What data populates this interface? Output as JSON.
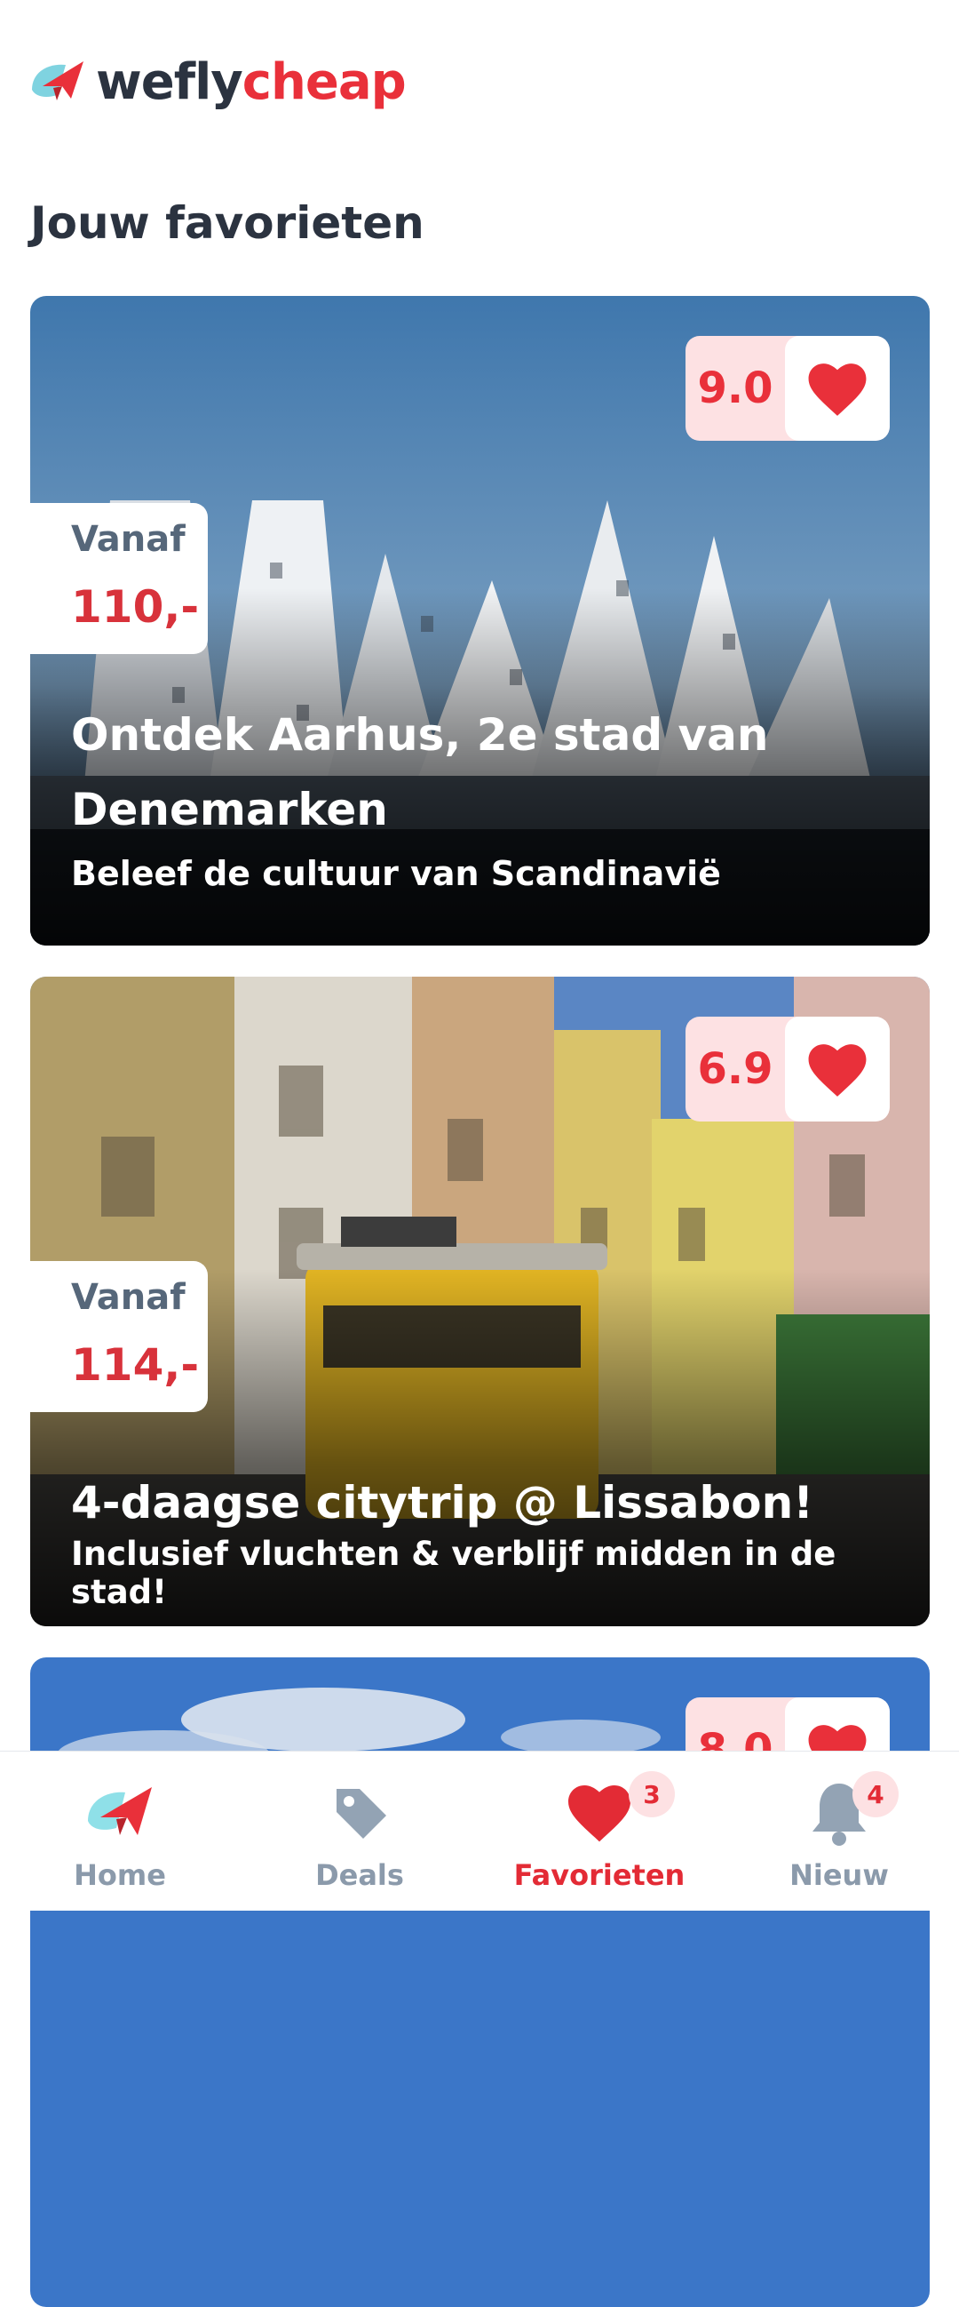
{
  "app": {
    "logo_we": "wefly",
    "logo_cheap": "cheap",
    "brand_color": "#e9303a"
  },
  "page": {
    "title": "Jouw favorieten"
  },
  "cards": [
    {
      "rating": "9.0",
      "price_label": "Vanaf",
      "price": "110,-",
      "title": "Ontdek Aarhus, 2e stad van Denemarken",
      "subtitle": "Beleef de cultuur van Scandinavië",
      "favorite_icon": "heart-icon"
    },
    {
      "rating": "6.9",
      "price_label": "Vanaf",
      "price": "114,-",
      "title": "4-daagse citytrip @ Lissabon!",
      "subtitle": "Inclusief vluchten & verblijf midden in de stad!",
      "favorite_icon": "heart-icon"
    },
    {
      "rating": "8.0",
      "favorite_icon": "heart-icon"
    }
  ],
  "tabbar": {
    "items": [
      {
        "label": "Home",
        "icon": "plane-logo-icon"
      },
      {
        "label": "Deals",
        "icon": "tag-icon"
      },
      {
        "label": "Favorieten",
        "icon": "heart-icon",
        "badge": "3",
        "active": true
      },
      {
        "label": "Nieuw",
        "icon": "bell-icon",
        "badge": "4"
      }
    ]
  }
}
